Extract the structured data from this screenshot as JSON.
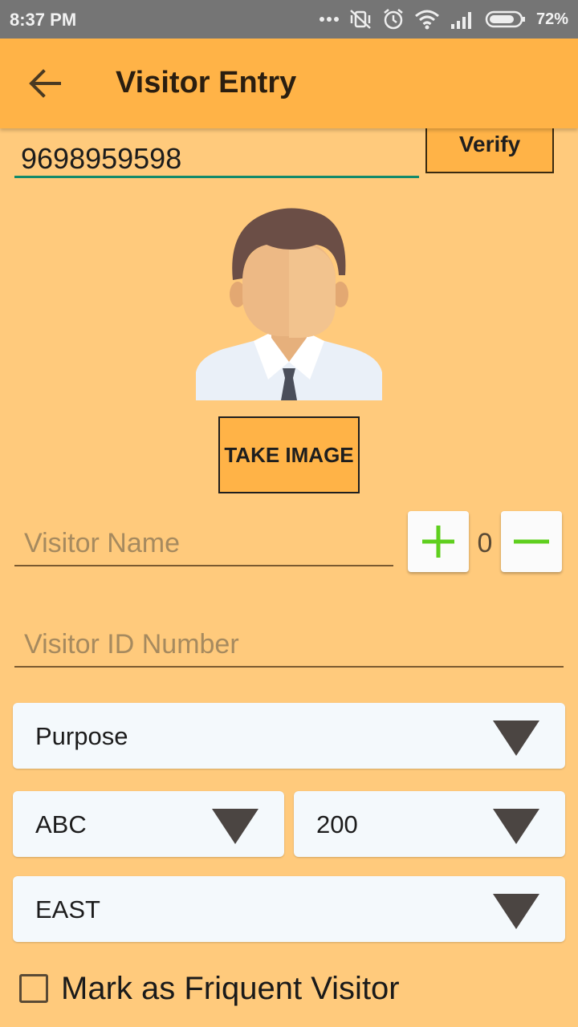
{
  "status_bar": {
    "time": "8:37 PM",
    "battery": "72%"
  },
  "app_bar": {
    "title": "Visitor Entry"
  },
  "phone": {
    "value": "9698959598"
  },
  "verify": {
    "label": "Verify"
  },
  "take_image": {
    "label": "TAKE IMAGE"
  },
  "visitor_name": {
    "placeholder": "Visitor Name"
  },
  "counter": {
    "value": "0"
  },
  "visitor_id": {
    "placeholder": "Visitor ID Number"
  },
  "dropdowns": {
    "purpose": "Purpose",
    "building": "ABC",
    "flat": "200",
    "wing": "EAST"
  },
  "frequent_visitor": {
    "label": "Mark as Friquent Visitor",
    "checked": false
  },
  "colors": {
    "background": "#FFCA7C",
    "app_bar": "#FFB347",
    "status_bar": "#757575",
    "accent_underline": "#138A6A",
    "stepper_icon": "#5FCF1E"
  },
  "icons": [
    "back-arrow-icon",
    "plus-icon",
    "minus-icon",
    "dropdown-arrow-icon",
    "avatar-placeholder"
  ]
}
